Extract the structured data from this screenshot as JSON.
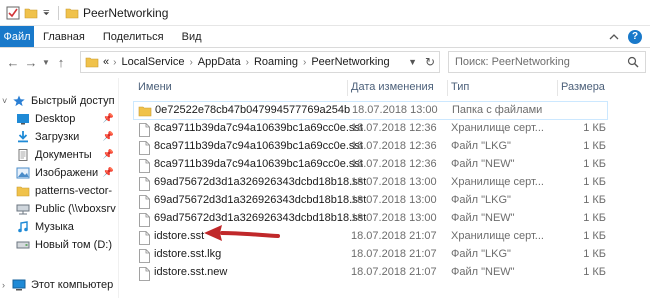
{
  "window": {
    "title": "PeerNetworking"
  },
  "ribbon": {
    "tabs": [
      {
        "label": "Файл"
      },
      {
        "label": "Главная"
      },
      {
        "label": "Поделиться"
      },
      {
        "label": "Вид"
      }
    ],
    "help_label": "?"
  },
  "address": {
    "prefix": "«",
    "segments": [
      "LocalService",
      "AppData",
      "Roaming",
      "PeerNetworking"
    ]
  },
  "search": {
    "placeholder": "Поиск: PeerNetworking"
  },
  "columns": {
    "name": "Имени",
    "date": "Дата изменения",
    "type": "Тип",
    "size": "Размера"
  },
  "sidebar": {
    "items": [
      {
        "label": "Быстрый доступ",
        "icon": "star-icon",
        "pinned": false
      },
      {
        "label": "Desktop",
        "icon": "desktop-icon",
        "pinned": true
      },
      {
        "label": "Загрузки",
        "icon": "downloads-icon",
        "pinned": true
      },
      {
        "label": "Документы",
        "icon": "documents-icon",
        "pinned": true
      },
      {
        "label": "Изображени",
        "icon": "pictures-icon",
        "pinned": true
      },
      {
        "label": "patterns-vector-",
        "icon": "folder-icon",
        "pinned": false
      },
      {
        "label": "Public (\\\\vboxsrv",
        "icon": "network-drive-icon",
        "pinned": false
      },
      {
        "label": "Музыка",
        "icon": "music-icon",
        "pinned": false
      },
      {
        "label": "Новый том (D:)",
        "icon": "drive-icon",
        "pinned": false
      },
      {
        "label": "Этот компьютер",
        "icon": "computer-icon",
        "pinned": false
      }
    ]
  },
  "files": [
    {
      "name": "0e72522e78cb47b047994577769a254b",
      "date": "18.07.2018 13:00",
      "type": "Папка с файлами",
      "size": "",
      "kind": "folder"
    },
    {
      "name": "8ca9711b39da7c94a10639bc1a69cc0e.sst",
      "date": "18.07.2018 12:36",
      "type": "Хранилище серт...",
      "size": "1 КБ",
      "kind": "file"
    },
    {
      "name": "8ca9711b39da7c94a10639bc1a69cc0e.sst",
      "date": "18.07.2018 12:36",
      "type": "Файл \"LKG\"",
      "size": "1 КБ",
      "kind": "file"
    },
    {
      "name": "8ca9711b39da7c94a10639bc1a69cc0e.sst",
      "date": "18.07.2018 12:36",
      "type": "Файл \"NEW\"",
      "size": "1 КБ",
      "kind": "file"
    },
    {
      "name": "69ad75672d3d1a326926343dcbd18b18.sst",
      "date": "18.07.2018 13:00",
      "type": "Хранилище серт...",
      "size": "1 КБ",
      "kind": "file"
    },
    {
      "name": "69ad75672d3d1a326926343dcbd18b18.sst",
      "date": "18.07.2018 13:00",
      "type": "Файл \"LKG\"",
      "size": "1 КБ",
      "kind": "file"
    },
    {
      "name": "69ad75672d3d1a326926343dcbd18b18.sst",
      "date": "18.07.2018 13:00",
      "type": "Файл \"NEW\"",
      "size": "1 КБ",
      "kind": "file"
    },
    {
      "name": "idstore.sst",
      "date": "18.07.2018 21:07",
      "type": "Хранилище серт...",
      "size": "1 КБ",
      "kind": "file"
    },
    {
      "name": "idstore.sst.lkg",
      "date": "18.07.2018 21:07",
      "type": "Файл \"LKG\"",
      "size": "1 КБ",
      "kind": "file"
    },
    {
      "name": "idstore.sst.new",
      "date": "18.07.2018 21:07",
      "type": "Файл \"NEW\"",
      "size": "1 КБ",
      "kind": "file"
    }
  ],
  "colors": {
    "accent": "#1979ca",
    "folder": "#f0c24b",
    "arrow": "#c0282a",
    "header_text": "#4c607a"
  }
}
